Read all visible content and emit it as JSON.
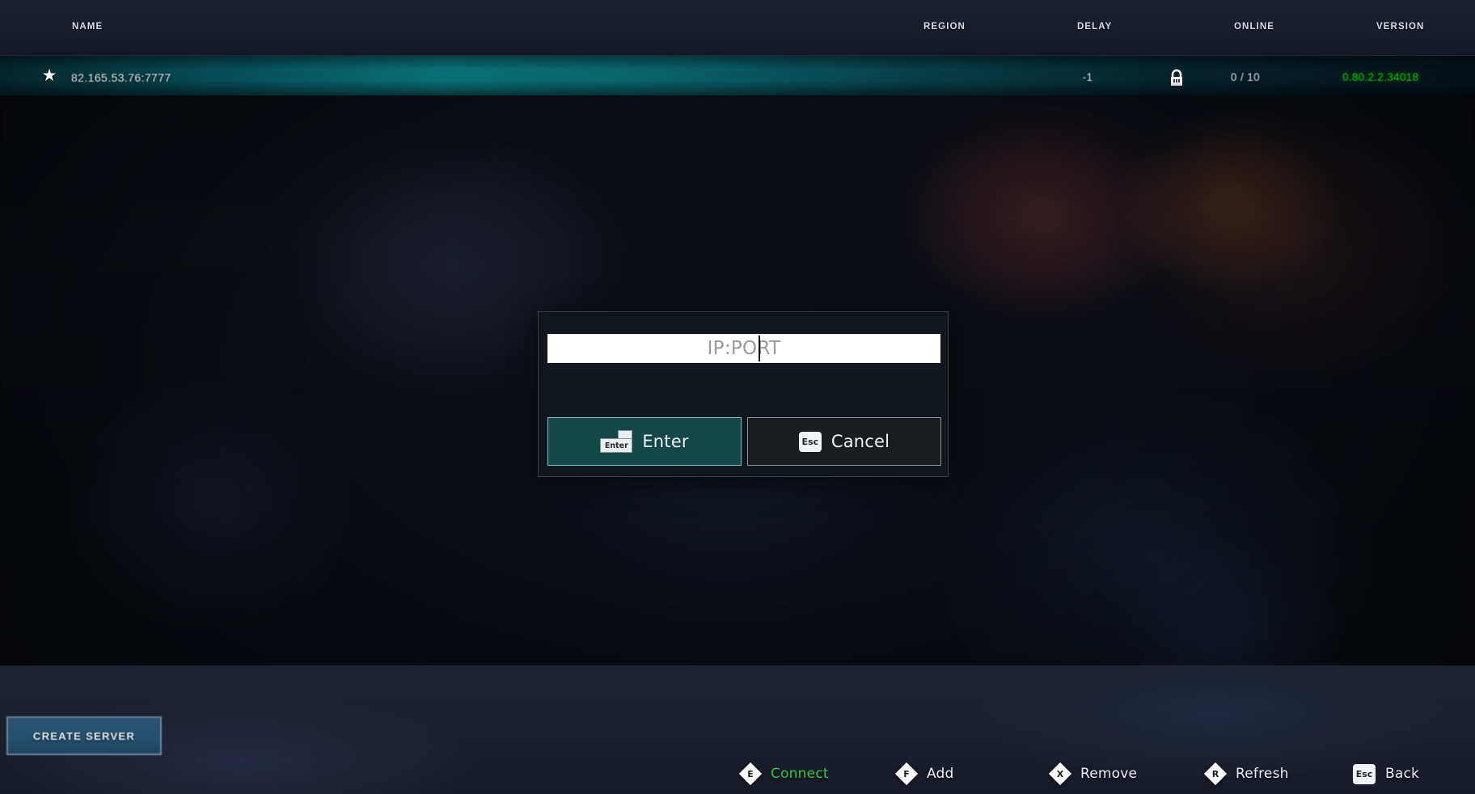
{
  "table": {
    "columns": [
      {
        "key": "name",
        "label": "NAME"
      },
      {
        "key": "region",
        "label": "REGION"
      },
      {
        "key": "delay",
        "label": "DELAY"
      },
      {
        "key": "online",
        "label": "ONLINE"
      },
      {
        "key": "version",
        "label": "VERSION"
      }
    ],
    "rows": [
      {
        "name": "82.165.53.76:7777",
        "favorite_icon": "star-icon",
        "region": "",
        "delay": "-1",
        "locked_icon": "lock-icon",
        "online": "0 / 10",
        "version": "0.80.2.2.34018",
        "selected": true
      }
    ]
  },
  "dialog": {
    "input": {
      "value": "",
      "placeholder": "IP:PORT",
      "caret_visible": true
    },
    "buttons": [
      {
        "key_label": "Enter",
        "label": "Enter",
        "style": "primary",
        "icon": "enter-key-icon"
      },
      {
        "key_label": "Esc",
        "label": "Cancel",
        "style": "secondary",
        "icon": "esc-key-icon"
      }
    ]
  },
  "footer": {
    "create_server_label": "CREATE SERVER",
    "hotkeys": [
      {
        "key": "E",
        "label": "Connect",
        "color": "#2fc943",
        "shape": "diamond"
      },
      {
        "key": "F",
        "label": "Add",
        "color": "#eef2f6",
        "shape": "diamond"
      },
      {
        "key": "X",
        "label": "Remove",
        "color": "#eef2f6",
        "shape": "diamond"
      },
      {
        "key": "R",
        "label": "Refresh",
        "color": "#eef2f6",
        "shape": "diamond"
      },
      {
        "key": "Esc",
        "label": "Back",
        "color": "#eef2f6",
        "shape": "square"
      }
    ]
  },
  "colors": {
    "accent_teal": "#0a747c",
    "version_green": "#14c314",
    "connect_green": "#2fc943",
    "primary_button_border": "#79c2c4",
    "create_server_blue": "#24506d"
  }
}
